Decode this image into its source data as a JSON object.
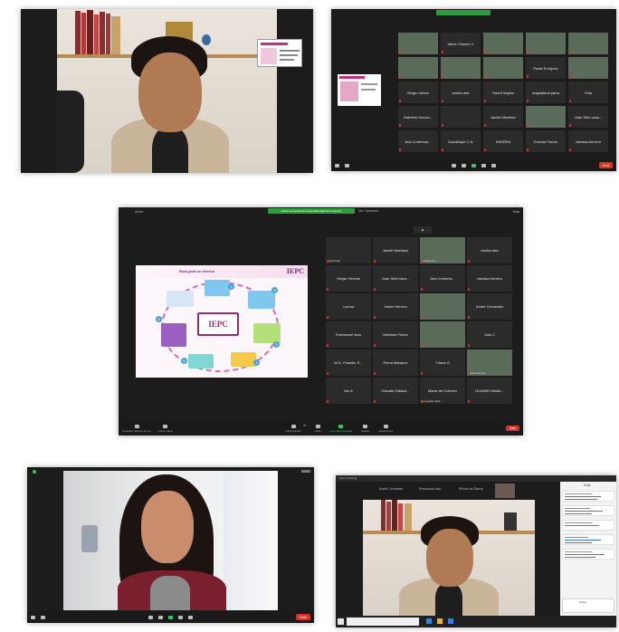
{
  "panel1": {
    "caption": "",
    "share_thumb_title": ""
  },
  "panel2": {
    "banner": "",
    "tiles": [
      {
        "name": ""
      },
      {
        "name": "Jaime Chavez V."
      },
      {
        "name": ""
      },
      {
        "name": ""
      },
      {
        "name": ""
      },
      {
        "name": ""
      },
      {
        "name": ""
      },
      {
        "name": ""
      },
      {
        "name": "Paola Enriquez"
      },
      {
        "name": ""
      },
      {
        "name": "Sergio Ireban"
      },
      {
        "name": "cecilia.diaz"
      },
      {
        "name": "Huerti Saylan"
      },
      {
        "name": "magdalena.parra"
      },
      {
        "name": "Fela"
      },
      {
        "name": "Gabriela Gomez..."
      },
      {
        "name": ""
      },
      {
        "name": "Janeth Martinez"
      },
      {
        "name": ""
      },
      {
        "name": "Juan Tello casa..."
      },
      {
        "name": "Ana Contreras..."
      },
      {
        "name": "Guadalupe C.A."
      },
      {
        "name": "ANDREA"
      },
      {
        "name": "Ernesto Torres"
      },
      {
        "name": "clarissa.herrera"
      }
    ],
    "end_label": "End"
  },
  "panel3": {
    "window_title": "Zoom",
    "banner": "Estás compartiendo la pantalla   Dejar de compartir",
    "view_label": "Ver: Opciones",
    "top_right": "Vista",
    "slide": {
      "title": "Ruta para un Interior",
      "logo": "IEPC",
      "center_logo": "IEPC",
      "steps": [
        "1",
        "2",
        "3",
        "4",
        "5",
        "6"
      ]
    },
    "gallery": [
      {
        "name": "",
        "caption": "Karla Tello"
      },
      {
        "name": "Janeth Martinez",
        "caption": ""
      },
      {
        "name": "",
        "caption": "Cristina Fer..."
      },
      {
        "name": "cecilia.diaz",
        "caption": ""
      },
      {
        "name": "Sergio Hernan",
        "caption": ""
      },
      {
        "name": "Juan Sebi caso...",
        "caption": ""
      },
      {
        "name": "Ana Contrera...",
        "caption": ""
      },
      {
        "name": "clarissa.herrera",
        "caption": ""
      },
      {
        "name": "Lorena",
        "caption": ""
      },
      {
        "name": "Javier Herrera",
        "caption": ""
      },
      {
        "name": "",
        "caption": ""
      },
      {
        "name": "André Cervantes",
        "caption": ""
      },
      {
        "name": "Emmanuel Ivan",
        "caption": ""
      },
      {
        "name": "Marisela Flores",
        "caption": ""
      },
      {
        "name": "",
        "caption": ""
      },
      {
        "name": "Julio C",
        "caption": ""
      },
      {
        "name": "M.D. Franklin S...",
        "caption": ""
      },
      {
        "name": "Elena Márquez",
        "caption": ""
      },
      {
        "name": "Yriana G",
        "caption": ""
      },
      {
        "name": "",
        "caption": "Karla Ruiz Zo..."
      },
      {
        "name": "Isis A",
        "caption": ""
      },
      {
        "name": "Claudia Gallard...",
        "caption": ""
      },
      {
        "name": "María del Carmen",
        "caption": "Compartir vista..."
      },
      {
        "name": "HUAWEI Media...",
        "caption": ""
      }
    ],
    "toolbar": {
      "left": [
        {
          "label": "Cancelar silencio de mi..."
        },
        {
          "label": "Iniciar video"
        }
      ],
      "center": [
        {
          "label": "Participantes"
        },
        {
          "label": "Chat"
        },
        {
          "label": "Compartir pantalla"
        },
        {
          "label": "Grabar"
        },
        {
          "label": "Reacciones"
        }
      ],
      "participants_count": "35",
      "end_label": "Salir"
    }
  },
  "panel4": {
    "caption": "",
    "hover_label": "",
    "end_label": "Salir"
  },
  "panel5": {
    "window_title": "Zoom Meeting",
    "strip": [
      "André Cervantes",
      "Emmanuel Ivan",
      "iPhone de Danny"
    ],
    "chat_title": "Chat",
    "chat_input_label": "Todos",
    "taskbar_search": ""
  },
  "colors": {
    "zoom_dark": "#1c1c1c",
    "end_red": "#d8352a",
    "share_green": "#2e9e3c",
    "slide_accent": "#7a2b7a"
  }
}
